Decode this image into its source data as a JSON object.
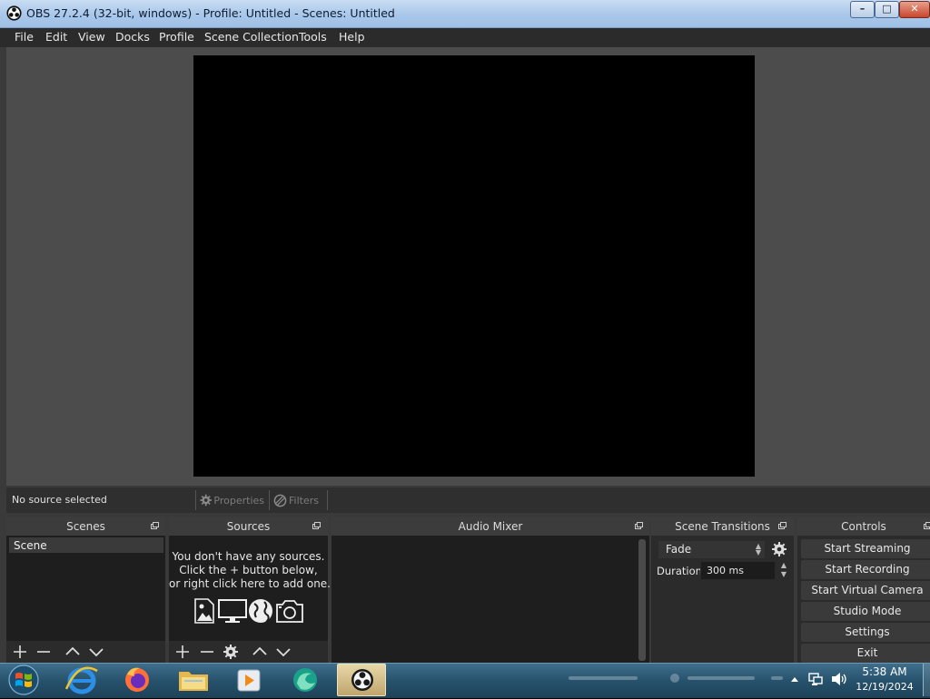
{
  "window": {
    "title": "OBS 27.2.4 (32-bit, windows) - Profile: Untitled - Scenes: Untitled",
    "controls": [
      "minimize",
      "maximize",
      "close"
    ]
  },
  "menu": [
    "File",
    "Edit",
    "View",
    "Docks",
    "Profile",
    "Scene Collection",
    "Tools",
    "Help"
  ],
  "context_bar": {
    "status": "No source selected",
    "properties": "Properties",
    "filters": "Filters"
  },
  "docks": {
    "scenes": {
      "title": "Scenes",
      "items": [
        "Scene"
      ]
    },
    "sources": {
      "title": "Sources",
      "empty_lines": [
        "You don't have any sources.",
        "Click the + button below,",
        "or right click here to add one."
      ]
    },
    "mixer": {
      "title": "Audio Mixer"
    },
    "transitions": {
      "title": "Scene Transitions",
      "selected": "Fade",
      "duration_label": "Duration",
      "duration_value": "300 ms"
    },
    "controls": {
      "title": "Controls",
      "buttons": [
        "Start Streaming",
        "Start Recording",
        "Start Virtual Camera",
        "Studio Mode",
        "Settings",
        "Exit"
      ]
    }
  },
  "taskbar": {
    "apps": [
      "internet-explorer",
      "firefox",
      "file-explorer",
      "media-player",
      "edge",
      "obs-studio"
    ],
    "clock_time": "5:38 AM",
    "clock_date": "12/19/2024"
  },
  "colors": {
    "panel": "#2b2b2b",
    "dock_body": "#1e1e1e",
    "preview_bg": "#4c4c4c",
    "canvas": "#000000",
    "titlebar": "#a9c7ea"
  }
}
